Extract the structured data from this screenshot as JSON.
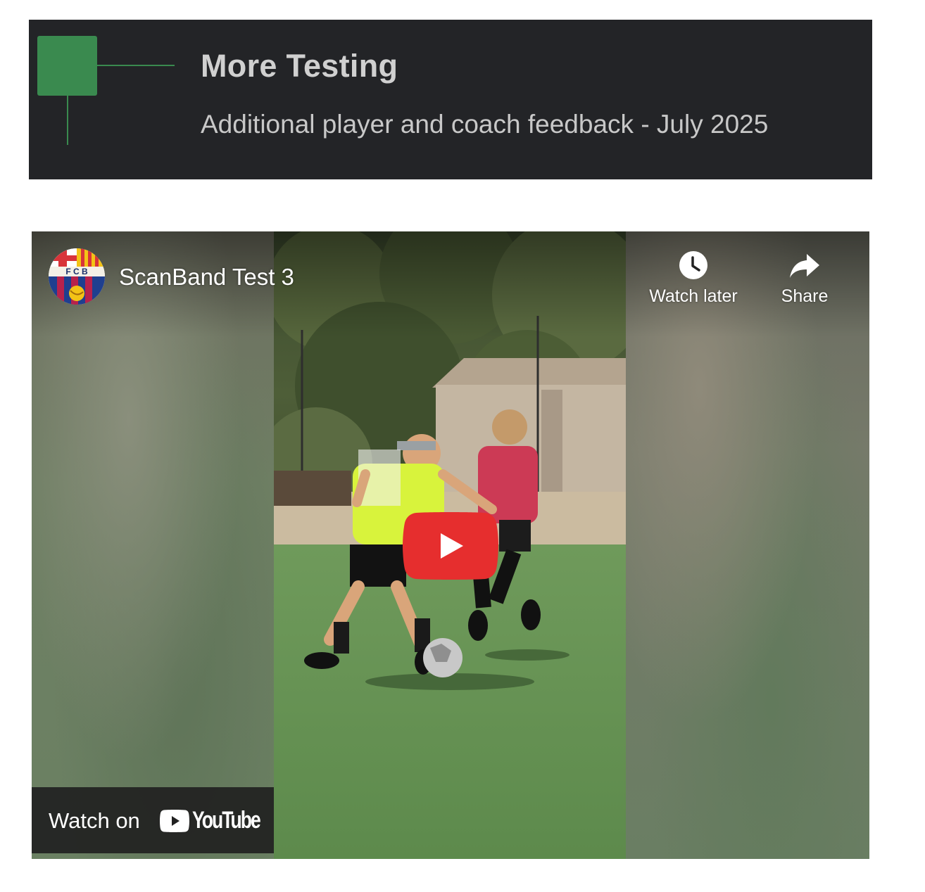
{
  "timeline": {
    "title": "More Testing",
    "subtitle": "Additional player and coach feedback - July 2025",
    "accent_color": "#3a8a4f"
  },
  "video": {
    "title": "ScanBand Test 3",
    "channel_avatar_text": "F C B",
    "watch_later_label": "Watch later",
    "share_label": "Share",
    "watch_on_label": "Watch on",
    "youtube_wordmark": "YouTube",
    "play_color": "#ff0000",
    "icons": [
      "clock-icon",
      "share-arrow-icon",
      "play-icon",
      "youtube-logo-icon"
    ]
  }
}
